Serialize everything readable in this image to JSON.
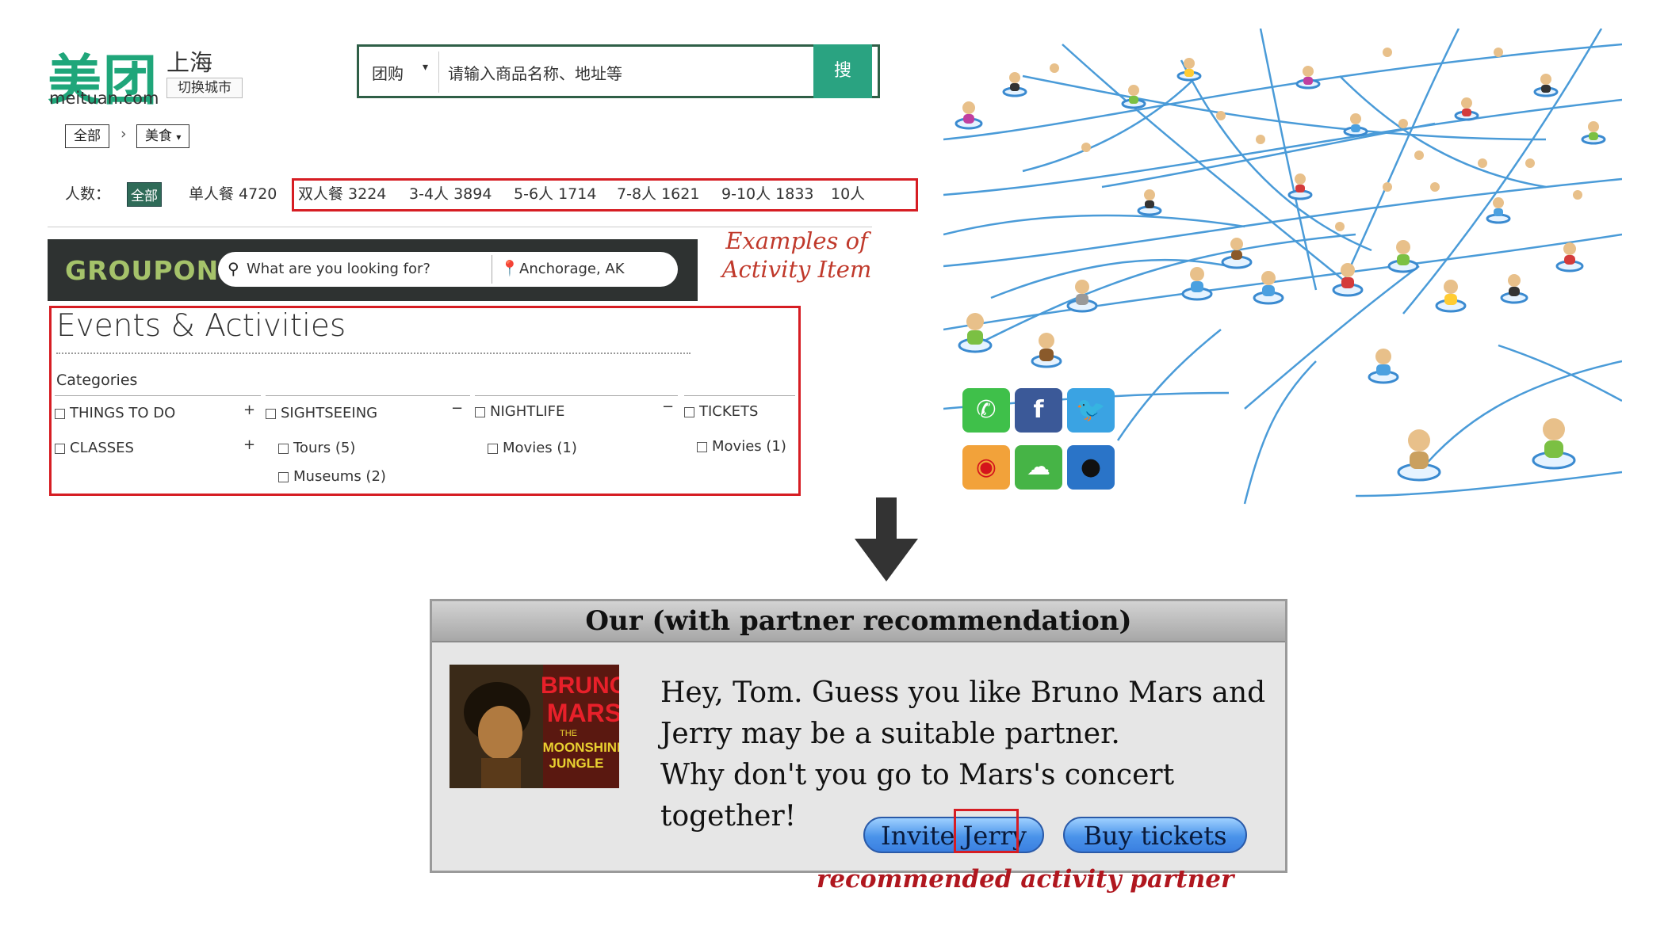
{
  "meituan": {
    "logo": "美团",
    "domain": "meituan.com",
    "city": "上海",
    "switch_city": "切换城市",
    "search_category": "团购",
    "search_placeholder": "请输入商品名称、地址等",
    "search_button": "搜",
    "breadcrumb": [
      "全部",
      "美食"
    ],
    "people_label": "人数：",
    "people_all": "全部",
    "people_single": "单人餐 4720",
    "people_options": [
      "双人餐 3224",
      "3-4人 3894",
      "5-6人 1714",
      "7-8人 1621",
      "9-10人 1833",
      "10人"
    ]
  },
  "annotations": {
    "activity_examples": "Examples of Activity Item",
    "partner": "recommended activity partner"
  },
  "groupon": {
    "logo": "GROUPON",
    "search_placeholder": "What are you looking for?",
    "location": "Anchorage, AK",
    "section_title": "Events & Activities",
    "categories_label": "Categories",
    "columns": [
      {
        "header": "THINGS TO DO",
        "toggle": "+",
        "items": [
          {
            "label": "CLASSES",
            "toggle": "+"
          }
        ]
      },
      {
        "header": "SIGHTSEEING",
        "toggle": "−",
        "items": [
          {
            "label": "Tours (5)"
          },
          {
            "label": "Museums (2)"
          }
        ]
      },
      {
        "header": "NIGHTLIFE",
        "toggle": "−",
        "items": [
          {
            "label": "Movies (1)"
          }
        ]
      },
      {
        "header": "TICKETS",
        "toggle": "",
        "items": [
          {
            "label": "Movies (1)"
          }
        ]
      }
    ]
  },
  "social_icons": [
    "whatsapp-icon",
    "facebook-icon",
    "twitter-icon",
    "weibo-icon",
    "wechat-icon",
    "qq-icon"
  ],
  "dialog": {
    "title": "Our (with partner recommendation)",
    "message_lines": [
      "Hey, Tom. Guess you like Bruno Mars and",
      "Jerry may be a suitable partner.",
      "Why don't you go to Mars's concert together!"
    ],
    "invite_prefix": "Invite ",
    "invite_partner": "Jerry",
    "buy_button": "Buy tickets",
    "album_text": [
      "BRUNO",
      "MARS",
      "THE",
      "MOONSHINE",
      "JUNGLE"
    ]
  },
  "colors": {
    "meituan_green": "#1fa67a",
    "groupon_green": "#a5c36a",
    "highlight_red": "#d61d23",
    "network_blue": "#4a9bd8"
  }
}
